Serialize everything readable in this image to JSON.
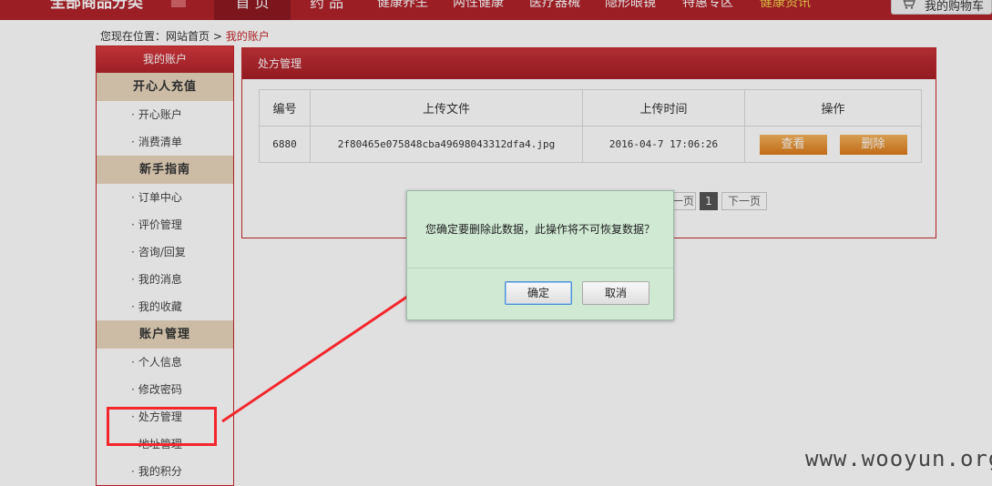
{
  "nav": {
    "all_categories": "全部商品分类",
    "items": [
      "首 页",
      "药 品",
      "健康养生",
      "两性健康",
      "医疗器械",
      "隐形眼镜",
      "特惠专区",
      "健康资讯"
    ],
    "cart_label": "我的购物车"
  },
  "breadcrumb": {
    "prefix": "您现在位置：",
    "home": "网站首页",
    "sep": ">",
    "current": "我的账户"
  },
  "sidebar": {
    "title": "我的账户",
    "sections": [
      {
        "heading": "开心人充值",
        "items": [
          "开心账户",
          "消费清单"
        ]
      },
      {
        "heading": "新手指南",
        "items": [
          "订单中心",
          "评价管理",
          "咨询/回复",
          "我的消息",
          "我的收藏"
        ]
      },
      {
        "heading": "账户管理",
        "items": [
          "个人信息",
          "修改密码",
          "处方管理",
          "地址管理",
          "我的积分"
        ]
      }
    ]
  },
  "panel": {
    "title": "处方管理",
    "columns": [
      "编号",
      "上传文件",
      "上传时间",
      "操作"
    ],
    "rows": [
      {
        "id": "6880",
        "file": "2f80465e075848cba49698043312dfa4.jpg",
        "time": "2016-04-7 17:06:26",
        "view": "查看",
        "delete": "删除"
      }
    ],
    "pager": {
      "prev": "一页",
      "page": "1",
      "next": "下一页"
    }
  },
  "dialog": {
    "message": "您确定要删除此数据，此操作将不可恢复数据？",
    "ok": "确定",
    "cancel": "取消"
  },
  "watermark": "www.wooyun.org",
  "colors": {
    "brand_red": "#b1232b",
    "dialog_bg": "#cfe9d3",
    "annotation_red": "#f3262c",
    "button_orange": "#e8901f"
  }
}
